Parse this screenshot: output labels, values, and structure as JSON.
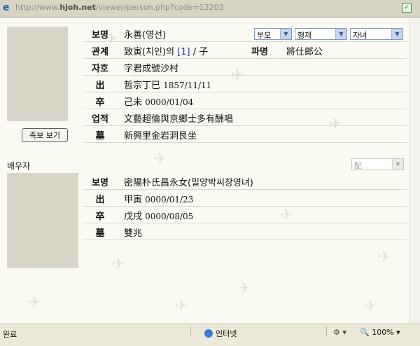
{
  "browser": {
    "url_prefix": "http://www.",
    "url_host": "hjoh.net",
    "url_path": "/viewer/person.php?code=13203"
  },
  "person": {
    "rows": [
      {
        "label": "보명",
        "value": "永善(영선)"
      },
      {
        "label": "관계",
        "value_prefix": "致寅(치인)의 ",
        "value_link": "[1]",
        "value_suffix": " / 子",
        "label2": "파명",
        "value2": "將仕郎公"
      },
      {
        "label": "자호",
        "value": "字君成號沙村"
      },
      {
        "label": "出",
        "value_prefix": "哲宗丁巳 ",
        "value_date": "1857/11/11"
      },
      {
        "label": "卒",
        "value_prefix": "己未 ",
        "value_date": "0000/01/04"
      },
      {
        "label": "업적",
        "value": "文藝超倫與京鄉士多有酬唱"
      },
      {
        "label": "墓",
        "value": "新興里金岩洞艮坐"
      }
    ],
    "select_parents": "부모",
    "select_siblings": "형제",
    "select_children": "자녀",
    "button_label": "족보 보기"
  },
  "spouse": {
    "label": "배우자",
    "select": "配",
    "rows": [
      {
        "label": "보명",
        "value": "密陽朴氏昌永女(밀양박씨창영녀)"
      },
      {
        "label": "出",
        "value_prefix": "甲寅 ",
        "value_date": "0000/01/23"
      },
      {
        "label": "卒",
        "value_prefix": "戊戌 ",
        "value_date": "0000/08/05"
      },
      {
        "label": "墓",
        "value": "雙兆"
      }
    ]
  },
  "status": {
    "left": "완료",
    "zone": "인터넷",
    "zoom": "100%"
  }
}
